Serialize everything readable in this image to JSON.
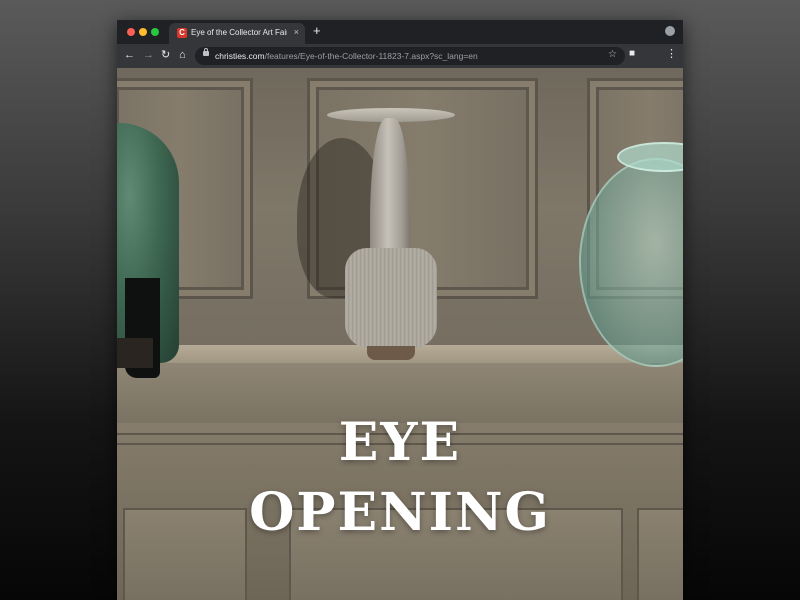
{
  "browser": {
    "tab": {
      "title": "Eye of the Collector Art Fair | C",
      "favicon_letter": "C",
      "close_glyph": "×"
    },
    "new_tab_glyph": "+",
    "address_bar": {
      "host": "christies.com",
      "path": "/features/Eye-of-the-Collector-11823-7.aspx?sc_lang=en"
    },
    "icons": {
      "back": "arrow-left-icon",
      "forward": "arrow-right-icon",
      "reload": "reload-icon",
      "home": "home-icon",
      "lock": "lock-icon",
      "bookmark": "star-icon",
      "extensions": "puzzle-icon",
      "menu": "kebab-menu-icon"
    },
    "traffic_lights": [
      "#ff5f57",
      "#febc2e",
      "#28c840"
    ]
  },
  "page": {
    "hero": {
      "line1": "EYE",
      "line2": "OPENING"
    }
  }
}
